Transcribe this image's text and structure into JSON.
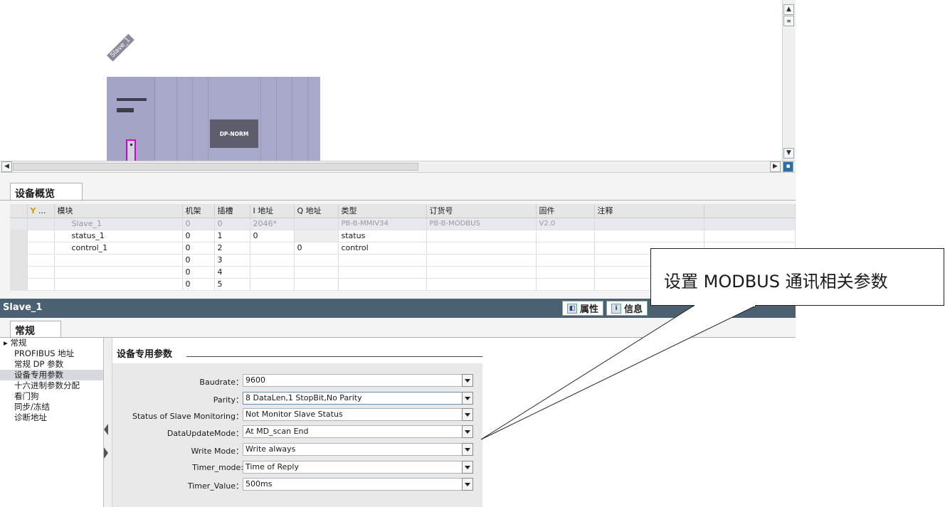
{
  "device_view": {
    "device_name": "Slave_1",
    "module_label": "DP-NORM"
  },
  "overview": {
    "tab_label": "设备概览",
    "columns": [
      "模块",
      "机架",
      "插槽",
      "I 地址",
      "Q 地址",
      "类型",
      "订货号",
      "固件",
      "注释"
    ],
    "ellipsis": "...",
    "rows": [
      {
        "module": "Slave_1",
        "rack": "0",
        "slot": "0",
        "i_addr": "2046*",
        "q_addr": "",
        "type": "PB-B-MMIV34",
        "order_no": "PB-B-MODBUS",
        "firmware": "V2.0",
        "comment": ""
      },
      {
        "module": "status_1",
        "rack": "0",
        "slot": "1",
        "i_addr": "0",
        "q_addr": "",
        "type": "status",
        "order_no": "",
        "firmware": "",
        "comment": ""
      },
      {
        "module": "control_1",
        "rack": "0",
        "slot": "2",
        "i_addr": "",
        "q_addr": "0",
        "type": "control",
        "order_no": "",
        "firmware": "",
        "comment": ""
      },
      {
        "module": "",
        "rack": "0",
        "slot": "3",
        "i_addr": "",
        "q_addr": "",
        "type": "",
        "order_no": "",
        "firmware": "",
        "comment": ""
      },
      {
        "module": "",
        "rack": "0",
        "slot": "4",
        "i_addr": "",
        "q_addr": "",
        "type": "",
        "order_no": "",
        "firmware": "",
        "comment": ""
      },
      {
        "module": "",
        "rack": "0",
        "slot": "5",
        "i_addr": "",
        "q_addr": "",
        "type": "",
        "order_no": "",
        "firmware": "",
        "comment": ""
      }
    ]
  },
  "properties": {
    "title": "Slave_1",
    "tabs": {
      "properties": "属性",
      "info": "信息"
    },
    "general_tab": "常规",
    "nav": [
      "常规",
      "PROFIBUS 地址",
      "常规 DP 参数",
      "设备专用参数",
      "十六进制参数分配",
      "看门狗",
      "同步/冻结",
      "诊断地址"
    ],
    "section_title": "设备专用参数",
    "params": [
      {
        "label": "Baudrate：",
        "value": "9600"
      },
      {
        "label": "Parity：",
        "value": "8 DataLen,1 StopBit,No Parity"
      },
      {
        "label": "Status of Slave Monitoring：",
        "value": "Not Monitor Slave Status"
      },
      {
        "label": "DataUpdateMode：",
        "value": "At MD_scan End"
      },
      {
        "label": "Write Mode：",
        "value": "Write always"
      },
      {
        "label": "Timer_mode:",
        "value": "Time of Reply"
      },
      {
        "label": "Timer_Value：",
        "value": "500ms"
      }
    ]
  },
  "callout": {
    "text": "设置 MODBUS 通讯相关参数"
  }
}
